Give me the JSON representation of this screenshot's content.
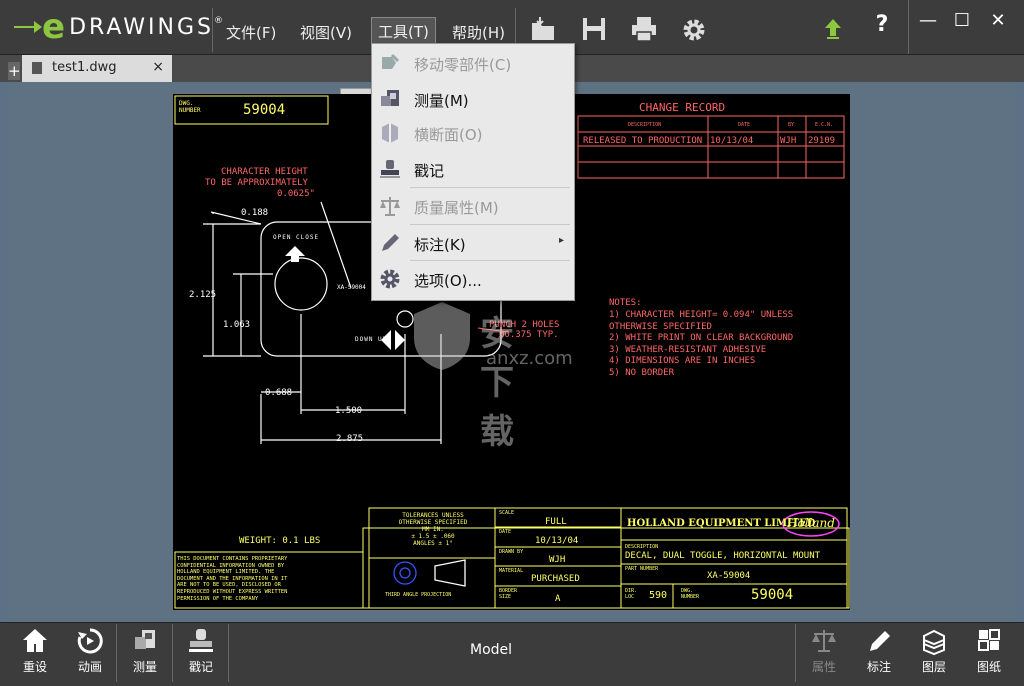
{
  "app": {
    "logo_e": "e",
    "logo_word": "DRAWINGS",
    "logo_reg": "®"
  },
  "menubar": {
    "file": "文件(F)",
    "view": "视图(V)",
    "tools": "工具(T)",
    "help": "帮助(H)"
  },
  "tab": {
    "name": "test1.dwg",
    "close": "×",
    "plus": "+"
  },
  "window": {
    "minimize": "—",
    "maximize": "☐",
    "close": "✕",
    "help": "?"
  },
  "tools_menu": [
    {
      "label": "移动零部件(C)",
      "enabled": false
    },
    {
      "label": "测量(M)",
      "enabled": true
    },
    {
      "label": "横断面(O)",
      "enabled": false
    },
    {
      "label": "戳记",
      "enabled": true
    },
    {
      "label": "质量属性(M)",
      "enabled": false
    },
    {
      "label": "标注(K)",
      "enabled": true,
      "submenu": "▸"
    },
    {
      "label": "选项(O)...",
      "enabled": true
    }
  ],
  "drawing": {
    "dwg_number_label1": "DWG.",
    "dwg_number_label2": "NUMBER",
    "dwg_number": "59004",
    "change_record": "CHANGE RECORD",
    "cr_headers": [
      "DESCRIPTION",
      "DATE",
      "BY",
      "E.C.N."
    ],
    "cr_row": {
      "desc": "RELEASED TO PRODUCTION",
      "date": "10/13/04",
      "by": "WJH",
      "ecn": "29109"
    },
    "char_height_1": "CHARACTER HEIGHT",
    "char_height_2": "TO BE APPROXIMATELY",
    "char_height_3": "0.0625\"",
    "dim_0188": "0.188",
    "dim_2125": "2.125",
    "dim_1063": "1.063",
    "dim_0688": "0.688",
    "dim_1500": "1.500",
    "dim_2875": "2.875",
    "open_close": "OPEN CLOSE",
    "down_up": "DOWN   UP",
    "part_label": "XA-59004",
    "punch_1": "PUNCH 2 HOLES",
    "punch_2": "Ø0.375 TYP.",
    "notes_title": "NOTES:",
    "notes": [
      "1) CHARACTER HEIGHT= 0.094\" UNLESS",
      "OTHERWISE  SPECIFIED",
      "2) WHITE PRINT ON CLEAR BACKGROUND",
      "3) WEATHER-RESISTANT ADHESIVE",
      "4) DIMENSIONS ARE IN INCHES",
      "5) NO BORDER"
    ],
    "weight": "WEIGHT:  0.1 LBS",
    "prop_text": [
      "THIS DOCUMENT CONTAINS PROPRIETARY",
      "CONFIDENTIAL INFORMATION OWNED BY",
      "HOLLAND EQUIPMENT LIMITED. THE",
      "DOCUMENT AND THE INFORMATION IN IT",
      "ARE NOT TO BE USED, DISCLOSED OR",
      "REPRODUCED WITHOUT EXPRESS WRITTEN",
      "PERMISSION OF THE COMPANY"
    ],
    "tolerances_1": "TOLERANCES UNLESS",
    "tolerances_2": "OTHERWISE SPECIFIED",
    "tol_mm": "MM        IN.",
    "tol_vals": "± 1.5    ± .060",
    "tol_angles": "ANGLES ± 1°",
    "third_angle": "THIRD ANGLE PROJECTION",
    "scale_label": "SCALE",
    "scale": "FULL",
    "date_label": "DATE",
    "date": "10/13/04",
    "drawn_label": "DRAWN BY",
    "drawn": "WJH",
    "material_label": "MATERIAL",
    "material": "PURCHASED",
    "border_label1": "BORDER",
    "border_label2": "SIZE",
    "border": "A",
    "company": "HOLLAND EQUIPMENT LIMITED",
    "holland_logo": "Holland",
    "desc_label": "DESCRIPTION",
    "desc": "DECAL, DUAL TOGGLE, HORIZONTAL MOUNT",
    "partno_label": "PART NUMBER",
    "partno": "XA-59004",
    "dir_label1": "DIR.",
    "dir_label2": "LOC",
    "dir": "590",
    "dwg2_label1": "DWG.",
    "dwg2_label2": "NUMBER",
    "dwg2": "59004"
  },
  "watermark": {
    "cn": "安下载",
    "en": "anxz.com"
  },
  "bottombar": {
    "reset": "重设",
    "animate": "动画",
    "measure": "测量",
    "stamp": "戳记",
    "model": "Model",
    "properties": "属性",
    "markup": "标注",
    "layers": "图层",
    "sheets": "图纸"
  }
}
